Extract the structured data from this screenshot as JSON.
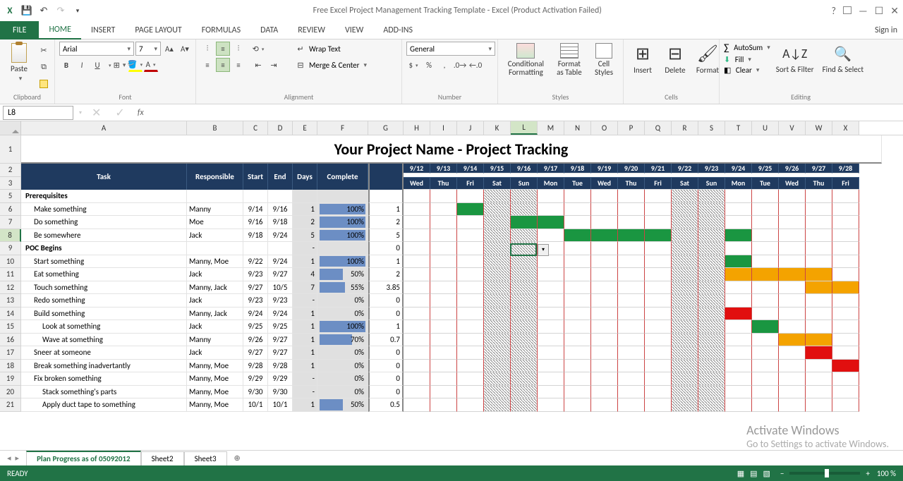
{
  "titlebar": {
    "title": "Free Excel Project Management Tracking Template - Excel (Product Activation Failed)"
  },
  "tabs": {
    "file": "FILE",
    "home": "HOME",
    "insert": "INSERT",
    "page": "PAGE LAYOUT",
    "formulas": "FORMULAS",
    "data": "DATA",
    "review": "REVIEW",
    "view": "VIEW",
    "addins": "ADD-INS",
    "signin": "Sign in"
  },
  "ribbon": {
    "clipboard": {
      "label": "Clipboard",
      "paste": "Paste"
    },
    "font": {
      "label": "Font",
      "family": "Arial",
      "size": "7",
      "bold": "B",
      "italic": "I",
      "underline": "U"
    },
    "alignment": {
      "label": "Alignment",
      "wrap": "Wrap Text",
      "merge": "Merge & Center"
    },
    "number": {
      "label": "Number",
      "format": "General"
    },
    "styles": {
      "label": "Styles",
      "cond": "Conditional Formatting",
      "fat": "Format as Table",
      "cell": "Cell Styles"
    },
    "cells": {
      "label": "Cells",
      "insert": "Insert",
      "delete": "Delete",
      "format": "Format"
    },
    "editing": {
      "label": "Editing",
      "autosum": "AutoSum",
      "fill": "Fill",
      "clear": "Clear",
      "sort": "Sort & Filter",
      "find": "Find & Select"
    }
  },
  "namebox": "L8",
  "sheet_title": "Your Project Name - Project Tracking",
  "cols": [
    "A",
    "B",
    "C",
    "D",
    "E",
    "F",
    "G",
    "H",
    "I",
    "J",
    "K",
    "L",
    "M",
    "N",
    "O",
    "P",
    "Q",
    "R",
    "S",
    "T",
    "U",
    "V",
    "W",
    "X"
  ],
  "headers2": {
    "task": "Task",
    "resp": "Responsible",
    "start": "Start",
    "end": "End",
    "days": "Days",
    "complete": "Complete"
  },
  "dates": [
    "9/12",
    "9/13",
    "9/14",
    "9/15",
    "9/16",
    "9/17",
    "9/18",
    "9/19",
    "9/20",
    "9/21",
    "9/22",
    "9/23",
    "9/24",
    "9/25",
    "9/26",
    "9/27",
    "9/28"
  ],
  "dows": [
    "Wed",
    "Thu",
    "Fri",
    "Sat",
    "Sun",
    "Mon",
    "Tue",
    "Wed",
    "Thu",
    "Fri",
    "Sat",
    "Sun",
    "Mon",
    "Tue",
    "Wed",
    "Thu",
    "Fri"
  ],
  "rows": [
    {
      "n": "5",
      "task": "Prerequisites",
      "bold": true,
      "indent": 0,
      "resp": "",
      "start": "",
      "end": "",
      "days": "",
      "complete": "",
      "g": ""
    },
    {
      "n": "6",
      "task": "Make something",
      "indent": 1,
      "resp": "Manny",
      "start": "9/14",
      "end": "9/16",
      "days": "1",
      "pct": 100,
      "g": "1",
      "bars": {
        "2": "g"
      }
    },
    {
      "n": "7",
      "task": "Do something",
      "indent": 1,
      "resp": "Moe",
      "start": "9/16",
      "end": "9/18",
      "days": "2",
      "pct": 100,
      "g": "2",
      "bars": {
        "4": "g",
        "5": "g"
      }
    },
    {
      "n": "8",
      "task": "Be somewhere",
      "indent": 1,
      "resp": "Jack",
      "start": "9/18",
      "end": "9/24",
      "days": "5",
      "pct": 100,
      "g": "5",
      "bars": {
        "6": "g",
        "7": "g",
        "8": "g",
        "9": "g",
        "12": "g"
      }
    },
    {
      "n": "9",
      "task": "POC Begins",
      "bold": true,
      "indent": 0,
      "resp": "",
      "start": "",
      "end": "",
      "days": "-",
      "complete": "",
      "g": "0"
    },
    {
      "n": "10",
      "task": "Start something",
      "indent": 1,
      "resp": "Manny, Moe",
      "start": "9/22",
      "end": "9/24",
      "days": "1",
      "pct": 100,
      "g": "1",
      "bars": {
        "12": "g"
      }
    },
    {
      "n": "11",
      "task": "Eat something",
      "indent": 1,
      "resp": "Jack",
      "start": "9/23",
      "end": "9/27",
      "days": "4",
      "pct": 50,
      "g": "2",
      "bars": {
        "12": "o",
        "13": "o",
        "14": "o",
        "15": "o"
      }
    },
    {
      "n": "12",
      "task": "Touch something",
      "indent": 1,
      "resp": "Manny, Jack",
      "start": "9/27",
      "end": "10/5",
      "days": "7",
      "pct": 55,
      "g": "3.85",
      "bars": {
        "15": "o",
        "16": "o"
      }
    },
    {
      "n": "13",
      "task": "Redo something",
      "indent": 1,
      "resp": "Jack",
      "start": "9/23",
      "end": "9/23",
      "days": "-",
      "pct": 0,
      "g": "0"
    },
    {
      "n": "14",
      "task": "Build something",
      "indent": 1,
      "resp": "Manny, Jack",
      "start": "9/24",
      "end": "9/24",
      "days": "1",
      "pct": 0,
      "g": "0",
      "bars": {
        "12": "r"
      }
    },
    {
      "n": "15",
      "task": "Look at something",
      "indent": 2,
      "resp": "Jack",
      "start": "9/25",
      "end": "9/25",
      "days": "1",
      "pct": 100,
      "g": "1",
      "bars": {
        "13": "g"
      }
    },
    {
      "n": "16",
      "task": "Wave at something",
      "indent": 2,
      "resp": "Manny",
      "start": "9/26",
      "end": "9/27",
      "days": "1",
      "pct": 70,
      "g": "0.7",
      "bars": {
        "14": "o",
        "15": "o"
      }
    },
    {
      "n": "17",
      "task": "Sneer at someone",
      "indent": 1,
      "resp": "Jack",
      "start": "9/27",
      "end": "9/27",
      "days": "1",
      "pct": 0,
      "g": "0",
      "bars": {
        "15": "r"
      }
    },
    {
      "n": "18",
      "task": "Break something inadvertantly",
      "indent": 1,
      "resp": "Manny, Moe",
      "start": "9/28",
      "end": "9/28",
      "days": "1",
      "pct": 0,
      "g": "0",
      "bars": {
        "16": "r"
      }
    },
    {
      "n": "19",
      "task": "Fix broken something",
      "indent": 1,
      "resp": "Manny, Moe",
      "start": "9/29",
      "end": "9/29",
      "days": "-",
      "pct": 0,
      "g": "0"
    },
    {
      "n": "20",
      "task": "Stack something's parts",
      "indent": 2,
      "resp": "Manny, Moe",
      "start": "9/30",
      "end": "9/30",
      "days": "-",
      "pct": 0,
      "g": "0"
    },
    {
      "n": "21",
      "task": "Apply duct tape to something",
      "indent": 2,
      "resp": "Manny, Moe",
      "start": "10/1",
      "end": "10/1",
      "days": "1",
      "pct": 50,
      "g": "0.5"
    }
  ],
  "weekend_cols": [
    3,
    4,
    10,
    11
  ],
  "sheets": {
    "s1": "Plan Progress as of 05092012",
    "s2": "Sheet2",
    "s3": "Sheet3"
  },
  "status": {
    "ready": "READY",
    "zoom": "100 %"
  },
  "watermark": {
    "title": "Activate Windows",
    "sub": "Go to Settings to activate Windows."
  }
}
